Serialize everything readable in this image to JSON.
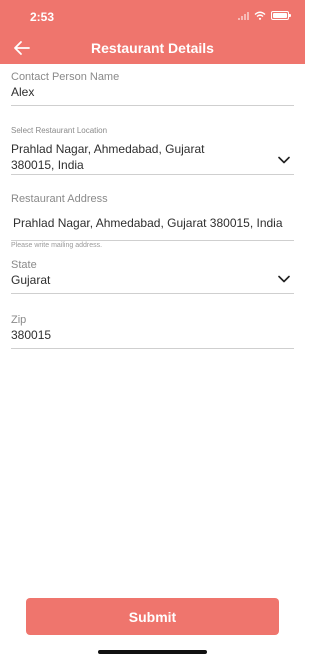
{
  "status_bar": {
    "time": "2:53"
  },
  "header": {
    "title": "Restaurant Details",
    "back_icon": "arrow-left-icon"
  },
  "form": {
    "contact_person": {
      "label": "Contact Person Name",
      "value": "Alex"
    },
    "location": {
      "label": "Select Restaurant Location",
      "value_line1": "Prahlad Nagar, Ahmedabad, Gujarat",
      "value_line2": "380015, India"
    },
    "address": {
      "label": "Restaurant Address",
      "value": "Prahlad Nagar, Ahmedabad, Gujarat 380015, India",
      "hint": "Please write mailing address."
    },
    "state": {
      "label": "State",
      "value": "Gujarat"
    },
    "zip": {
      "label": "Zip",
      "value": "380015"
    }
  },
  "submit_label": "Submit",
  "colors": {
    "accent": "#ef756d"
  }
}
